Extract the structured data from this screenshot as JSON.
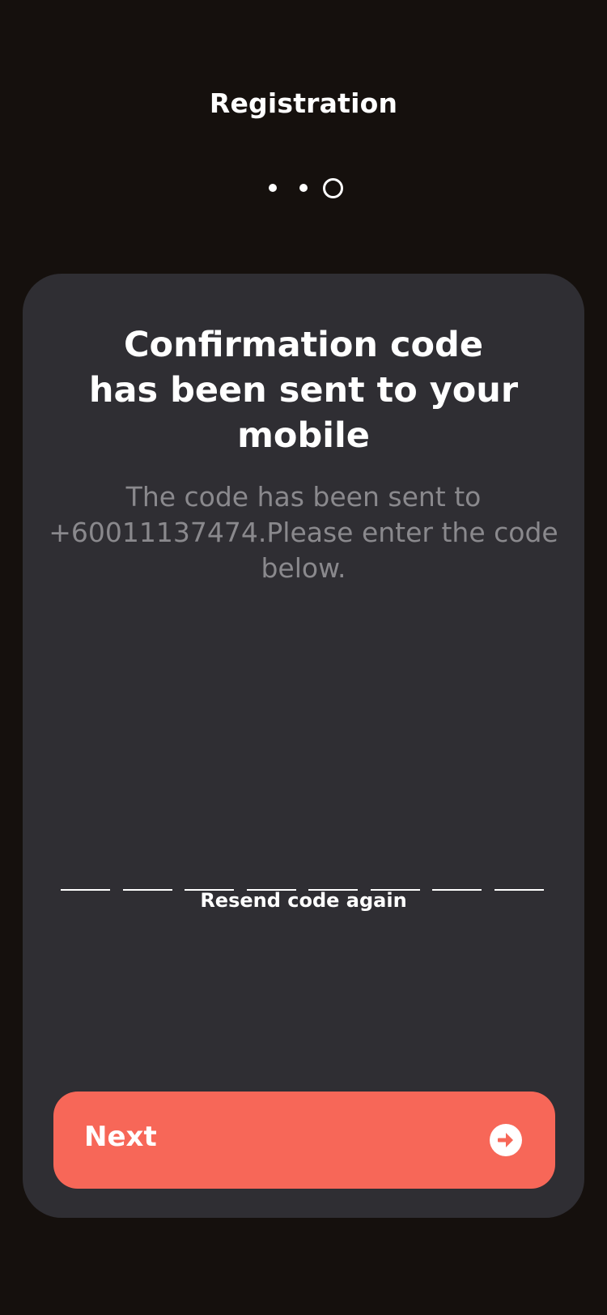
{
  "header": {
    "title": "Registration"
  },
  "stepper": {
    "current_step": 3,
    "total_steps": 3
  },
  "card": {
    "heading_lines": [
      "Confirmation code",
      "has been sent to your",
      "mobile"
    ],
    "subtext": "The code has been sent to +60011137474.Please enter the code below.",
    "code_length": 8,
    "code_values": [
      "",
      "",
      "",
      "",
      "",
      "",
      "",
      ""
    ],
    "resend_label": "Resend code again"
  },
  "next_button": {
    "label": "Next",
    "icon": "arrow-right-circle-icon"
  },
  "colors": {
    "background": "#15100d",
    "card": "#2f2e33",
    "accent": "#f76758",
    "muted_text": "#8a898d",
    "text": "#ffffff"
  }
}
